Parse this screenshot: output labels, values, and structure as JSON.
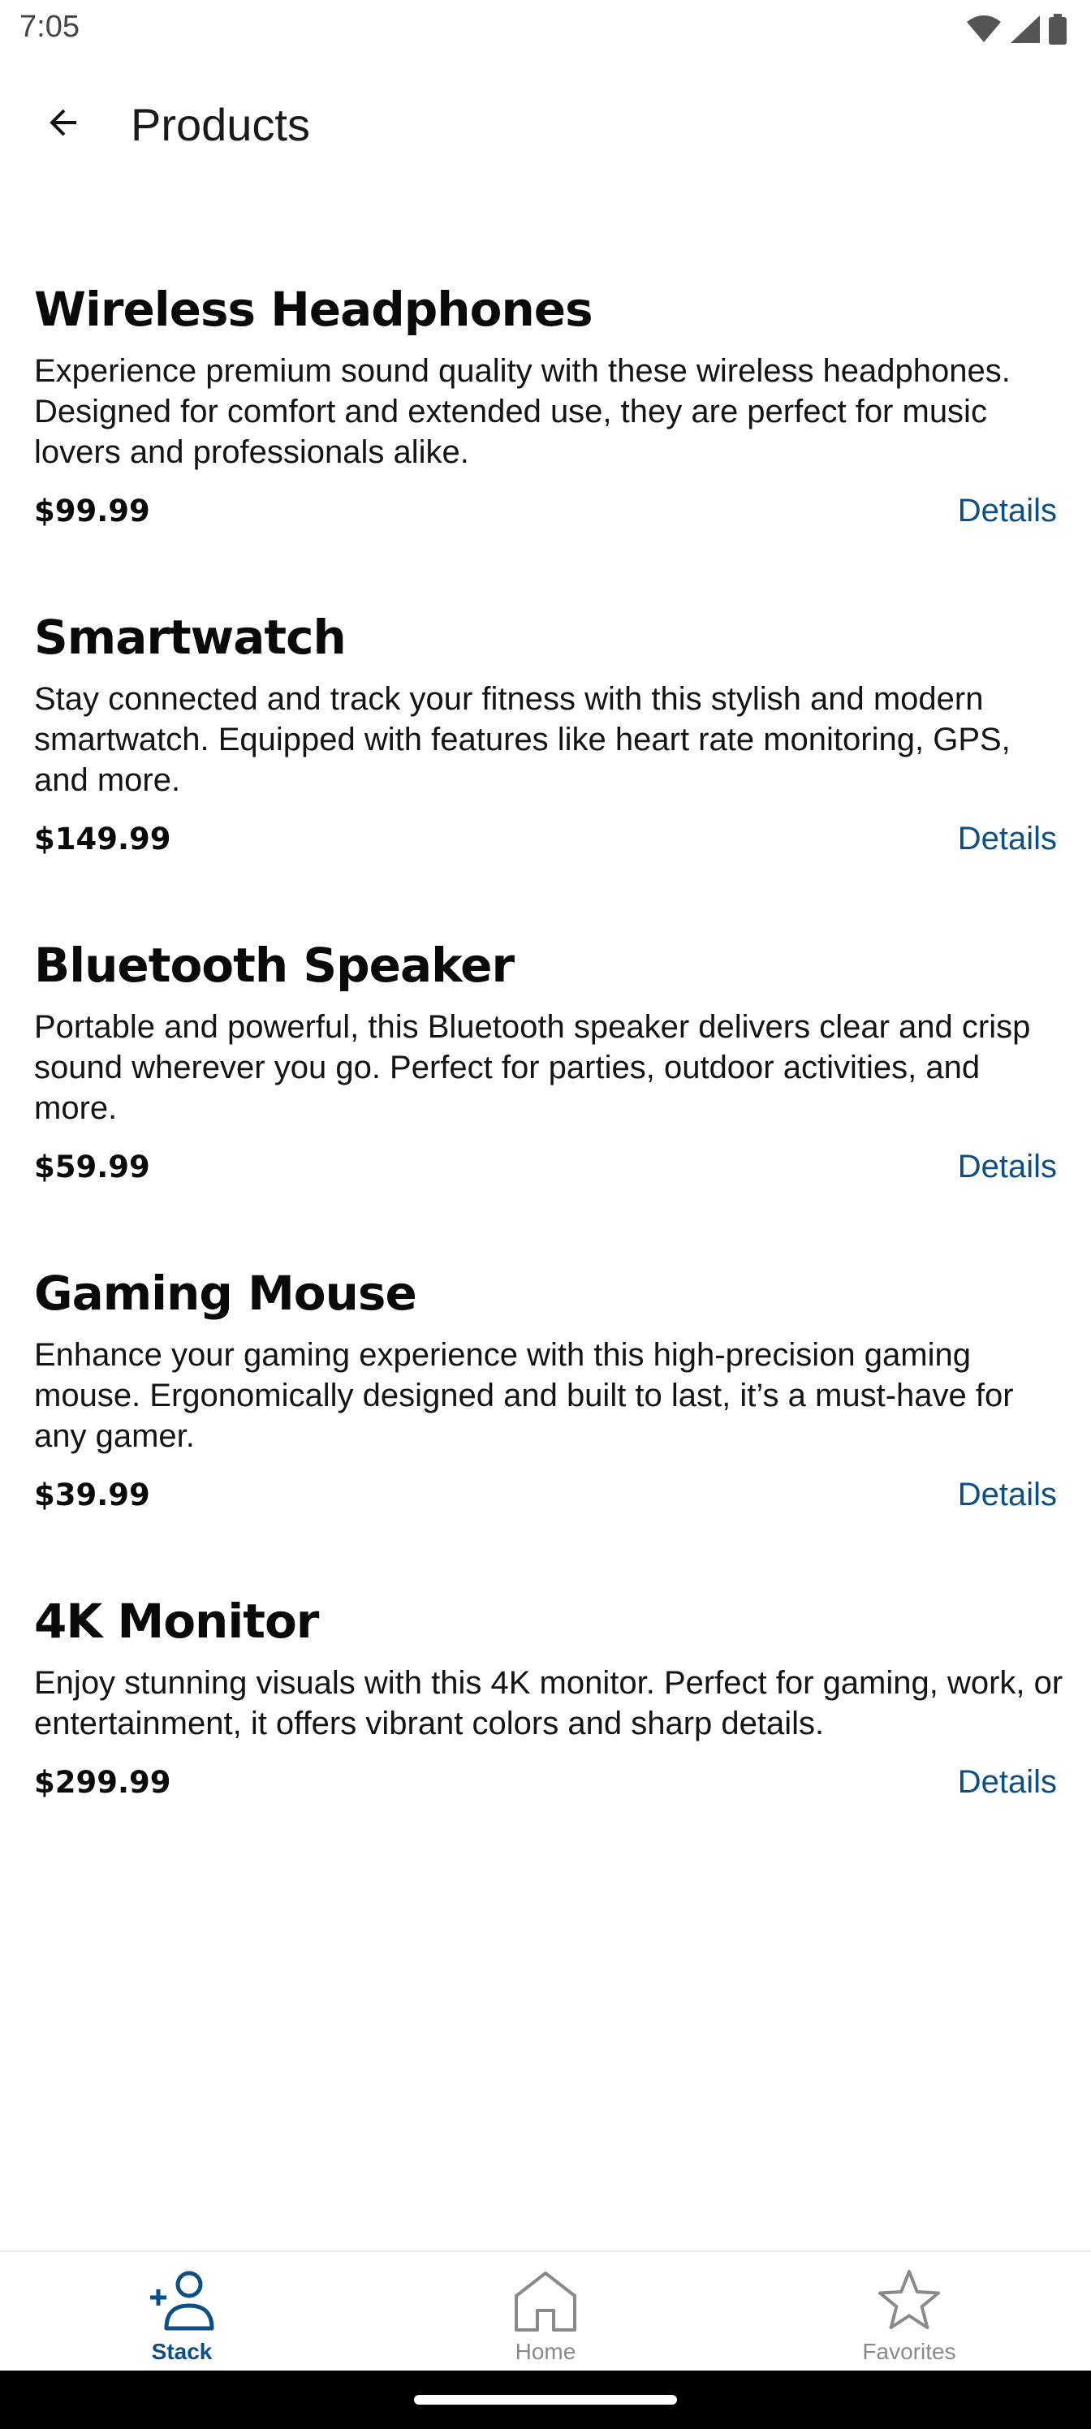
{
  "status_bar": {
    "time": "7:05",
    "icons": [
      "wifi-icon",
      "signal-icon",
      "battery-icon"
    ]
  },
  "app_bar": {
    "title": "Products",
    "back_icon": "arrow-back-icon"
  },
  "products": [
    {
      "name": "Wireless Headphones",
      "description": "Experience premium sound quality with these wireless headphones. Designed for comfort and extended use, they are perfect for music lovers and professionals alike.",
      "price": "$99.99",
      "details_label": "Details"
    },
    {
      "name": "Smartwatch",
      "description": "Stay connected and track your fitness with this stylish and modern smartwatch. Equipped with features like heart rate monitoring, GPS, and more.",
      "price": "$149.99",
      "details_label": "Details"
    },
    {
      "name": "Bluetooth Speaker",
      "description": "Portable and powerful, this Bluetooth speaker delivers clear and crisp sound wherever you go. Perfect for parties, outdoor activities, and more.",
      "price": "$59.99",
      "details_label": "Details"
    },
    {
      "name": "Gaming Mouse",
      "description": "Enhance your gaming experience with this high-precision gaming mouse. Ergonomically designed and built to last, it’s a must-have for any gamer.",
      "price": "$39.99",
      "details_label": "Details"
    },
    {
      "name": "4K Monitor",
      "description": "Enjoy stunning visuals with this 4K monitor. Perfect for gaming, work, or entertainment, it offers vibrant colors and sharp details.",
      "price": "$299.99",
      "details_label": "Details"
    }
  ],
  "bottom_nav": {
    "items": [
      {
        "label": "Stack",
        "icon": "person-add-icon",
        "active": true
      },
      {
        "label": "Home",
        "icon": "home-icon",
        "active": false
      },
      {
        "label": "Favorites",
        "icon": "star-icon",
        "active": false
      }
    ]
  },
  "colors": {
    "accent": "#0b4f86",
    "inactive": "#8a8a8a",
    "text": "#111111",
    "background": "#ffffff"
  }
}
